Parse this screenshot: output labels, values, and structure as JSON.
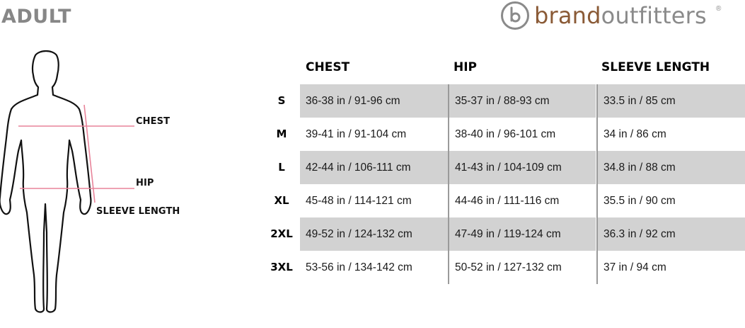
{
  "title": "ADULT",
  "logo": {
    "brand": "brand",
    "rest": "outfitters",
    "mark": "®",
    "icon": "b-circle-logo-icon"
  },
  "figure": {
    "labels": {
      "chest": "CHEST",
      "hip": "HIP",
      "sleeve": "SLEEVE LENGTH"
    },
    "line_color": "#e8849a"
  },
  "table": {
    "headers": [
      "CHEST",
      "HIP",
      "SLEEVE LENGTH"
    ],
    "rows": [
      {
        "size": "S",
        "chest": "36-38 in / 91-96 cm",
        "hip": "35-37 in / 88-93 cm",
        "sleeve": "33.5 in / 85 cm"
      },
      {
        "size": "M",
        "chest": "39-41 in / 91-104 cm",
        "hip": "38-40 in / 96-101 cm",
        "sleeve": "34 in / 86 cm"
      },
      {
        "size": "L",
        "chest": "42-44 in / 106-111 cm",
        "hip": "41-43 in / 104-109 cm",
        "sleeve": "34.8 in / 88 cm"
      },
      {
        "size": "XL",
        "chest": "45-48 in / 114-121 cm",
        "hip": "44-46 in / 111-116 cm",
        "sleeve": "35.5 in / 90 cm"
      },
      {
        "size": "2XL",
        "chest": "49-52 in / 124-132 cm",
        "hip": "47-49 in / 119-124 cm",
        "sleeve": "36.3 in / 92 cm"
      },
      {
        "size": "3XL",
        "chest": "53-56 in / 134-142 cm",
        "hip": "50-52 in / 127-132 cm",
        "sleeve": "37 in / 94 cm"
      }
    ],
    "shade_color": "#d2d2d2"
  }
}
